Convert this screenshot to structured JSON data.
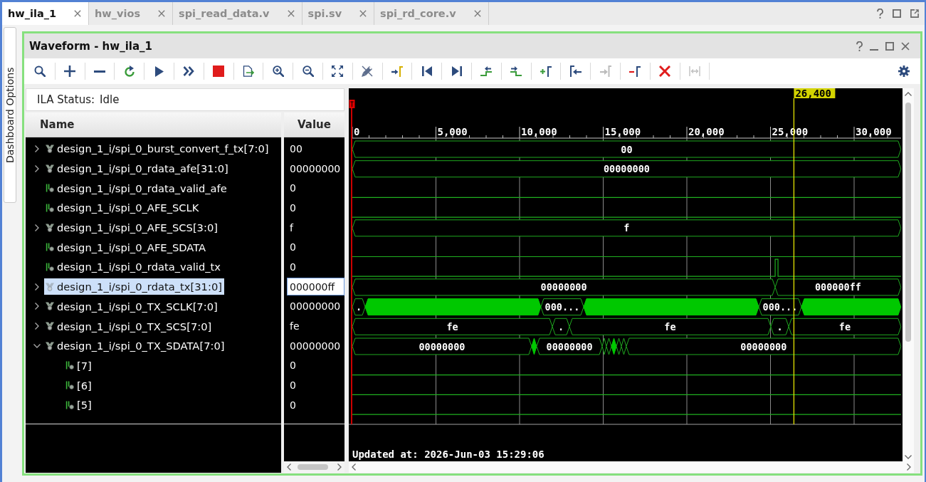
{
  "tabs": [
    {
      "label": "hw_ila_1",
      "selected": true
    },
    {
      "label": "hw_vios",
      "selected": false
    },
    {
      "label": "spi_read_data.v",
      "selected": false
    },
    {
      "label": "spi.sv",
      "selected": false
    },
    {
      "label": "spi_rd_core.v",
      "selected": false
    }
  ],
  "side_tab": {
    "label": "Dashboard Options"
  },
  "panel": {
    "title": "Waveform - hw_ila_1",
    "toolbar": [
      {
        "kind": "search",
        "disabled": false
      },
      {
        "kind": "add",
        "disabled": false
      },
      {
        "kind": "remove",
        "disabled": false
      },
      {
        "kind": "refresh",
        "disabled": false
      },
      {
        "kind": "run",
        "disabled": false
      },
      {
        "kind": "fastforward",
        "disabled": false
      },
      {
        "kind": "stop",
        "disabled": false
      },
      {
        "kind": "export",
        "disabled": false
      },
      {
        "kind": "zoomin",
        "disabled": false
      },
      {
        "kind": "zoomout",
        "disabled": false
      },
      {
        "kind": "fit",
        "disabled": false
      },
      {
        "kind": "snap",
        "disabled": false
      },
      {
        "kind": "cursor",
        "disabled": false
      },
      {
        "kind": "first",
        "disabled": false
      },
      {
        "kind": "last",
        "disabled": false
      },
      {
        "kind": "prevedge",
        "disabled": false
      },
      {
        "kind": "nextedge",
        "disabled": false
      },
      {
        "kind": "addmarker",
        "disabled": false
      },
      {
        "kind": "prevmarker",
        "disabled": false
      },
      {
        "kind": "nextmarker",
        "disabled": true
      },
      {
        "kind": "deletemarker",
        "disabled": false
      },
      {
        "kind": "clear",
        "disabled": false
      },
      {
        "kind": "distance",
        "disabled": true
      },
      {
        "kind": "settings",
        "disabled": false
      }
    ],
    "ila_status": {
      "label": "ILA Status:",
      "value": "Idle"
    },
    "columns": [
      "Name",
      "Value"
    ],
    "signals": [
      {
        "name": "design_1_i/spi_0_burst_convert_f_tx[7:0]",
        "value": "00",
        "kind": "bus",
        "expanded": false,
        "selected": false
      },
      {
        "name": "design_1_i/spi_0_rdata_afe[31:0]",
        "value": "00000000",
        "kind": "bus",
        "expanded": false,
        "selected": false
      },
      {
        "name": "design_1_i/spi_0_rdata_valid_afe",
        "value": "0",
        "kind": "bit",
        "selected": false
      },
      {
        "name": "design_1_i/spi_0_AFE_SCLK",
        "value": "0",
        "kind": "bit",
        "selected": false
      },
      {
        "name": "design_1_i/spi_0_AFE_SCS[3:0]",
        "value": "f",
        "kind": "bus",
        "expanded": false,
        "selected": false
      },
      {
        "name": "design_1_i/spi_0_AFE_SDATA",
        "value": "0",
        "kind": "bit",
        "selected": false
      },
      {
        "name": "design_1_i/spi_0_rdata_valid_tx",
        "value": "0",
        "kind": "bit",
        "selected": false
      },
      {
        "name": "design_1_i/spi_0_rdata_tx[31:0]",
        "value": "000000ff",
        "kind": "bus",
        "expanded": false,
        "selected": true
      },
      {
        "name": "design_1_i/spi_0_TX_SCLK[7:0]",
        "value": "00000000",
        "kind": "bus",
        "expanded": false,
        "selected": false
      },
      {
        "name": "design_1_i/spi_0_TX_SCS[7:0]",
        "value": "fe",
        "kind": "bus",
        "expanded": false,
        "selected": false
      },
      {
        "name": "design_1_i/spi_0_TX_SDATA[7:0]",
        "value": "00000000",
        "kind": "bus",
        "expanded": true,
        "selected": false,
        "children": [
          {
            "name": "[7]",
            "value": "0",
            "kind": "bit",
            "selected": false
          },
          {
            "name": "[6]",
            "value": "0",
            "kind": "bit",
            "selected": false
          },
          {
            "name": "[5]",
            "value": "0",
            "kind": "bit",
            "selected": false
          }
        ]
      }
    ],
    "waveform": {
      "ruler_ticks": [
        "0",
        "5,000",
        "10,000",
        "15,000",
        "20,000",
        "25,000",
        "30,000"
      ],
      "cursor": {
        "label": "26,400"
      },
      "traces": [
        {
          "kind": "bus",
          "segments": [
            {
              "kind": "value",
              "label": "00"
            }
          ]
        },
        {
          "kind": "bus",
          "segments": [
            {
              "kind": "value",
              "label": "00000000"
            }
          ]
        },
        {
          "kind": "bit",
          "segments": [
            {
              "kind": "low"
            }
          ]
        },
        {
          "kind": "bit",
          "segments": [
            {
              "kind": "low"
            }
          ]
        },
        {
          "kind": "bus",
          "segments": [
            {
              "kind": "value",
              "label": "f"
            }
          ]
        },
        {
          "kind": "bit",
          "segments": [
            {
              "kind": "low"
            }
          ]
        },
        {
          "kind": "bit",
          "segments": [
            {
              "kind": "low"
            },
            {
              "kind": "high"
            },
            {
              "kind": "low"
            }
          ]
        },
        {
          "kind": "bus",
          "segments": [
            {
              "kind": "value",
              "label": "00000000"
            },
            {
              "kind": "value",
              "label": "000000ff"
            }
          ]
        },
        {
          "kind": "bus",
          "segments": [
            {
              "kind": "value",
              "label": "."
            },
            {
              "kind": "dense"
            },
            {
              "kind": "value",
              "label": "000..."
            },
            {
              "kind": "dense"
            },
            {
              "kind": "value",
              "label": "000..."
            },
            {
              "kind": "dense"
            }
          ]
        },
        {
          "kind": "bus",
          "segments": [
            {
              "kind": "value",
              "label": "fe"
            },
            {
              "kind": "value",
              "label": "."
            },
            {
              "kind": "value",
              "label": "fe"
            },
            {
              "kind": "value",
              "label": "."
            },
            {
              "kind": "value",
              "label": "fe"
            }
          ]
        },
        {
          "kind": "bus",
          "segments": [
            {
              "kind": "value",
              "label": "00000000"
            },
            {
              "kind": "dense"
            },
            {
              "kind": "value",
              "label": "00000000"
            },
            {
              "kind": "value"
            },
            {
              "kind": "value"
            },
            {
              "kind": "dense"
            },
            {
              "kind": "value"
            },
            {
              "kind": "value"
            },
            {
              "kind": "value",
              "label": "00000000"
            }
          ]
        },
        {
          "kind": "bit",
          "segments": [
            {
              "kind": "low"
            }
          ]
        },
        {
          "kind": "bit",
          "segments": [
            {
              "kind": "low"
            }
          ]
        },
        {
          "kind": "bit",
          "segments": [
            {
              "kind": "low"
            }
          ]
        }
      ],
      "status": "Updated at: 2026-Jun-03 15:29:06"
    }
  }
}
